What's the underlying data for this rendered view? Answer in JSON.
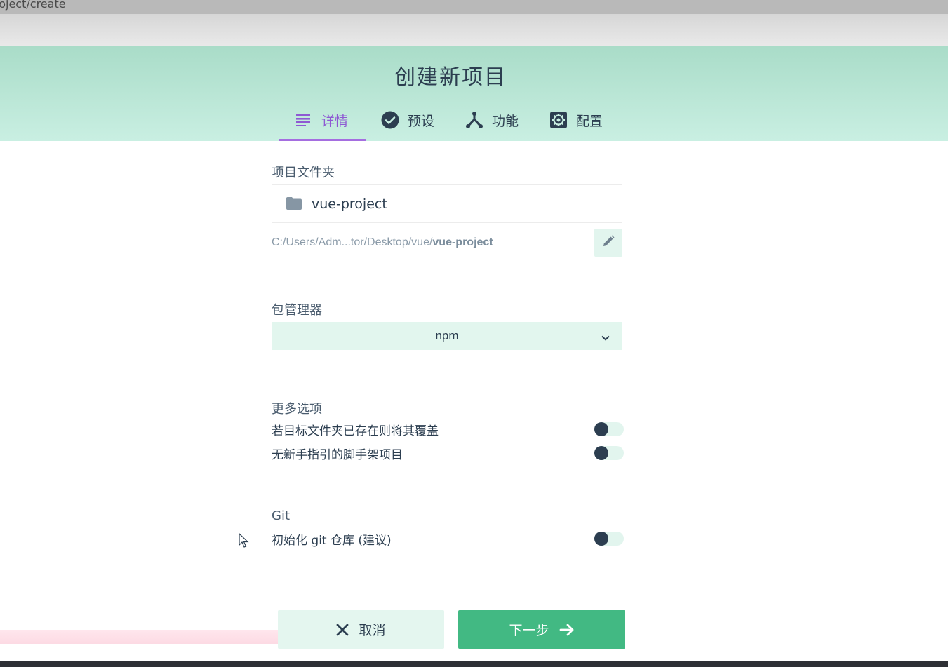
{
  "browser": {
    "url_fragment": "roject/create"
  },
  "header": {
    "title": "创建新项目",
    "tabs": [
      {
        "label": "详情",
        "icon": "list-icon",
        "active": true
      },
      {
        "label": "预设",
        "icon": "check-circle-icon",
        "active": false
      },
      {
        "label": "功能",
        "icon": "fork-icon",
        "active": false
      },
      {
        "label": "配置",
        "icon": "gear-icon",
        "active": false
      }
    ]
  },
  "project_folder": {
    "label": "项目文件夹",
    "value": "vue-project",
    "path_prefix": "C:/Users/Adm...tor/Desktop/vue/",
    "path_name": "vue-project"
  },
  "package_manager": {
    "label": "包管理器",
    "selected": "npm"
  },
  "more_options": {
    "label": "更多选项",
    "items": [
      {
        "label": "若目标文件夹已存在则将其覆盖",
        "enabled": false
      },
      {
        "label": "无新手指引的脚手架项目",
        "enabled": false
      }
    ]
  },
  "git": {
    "label": "Git",
    "items": [
      {
        "label": "初始化 git 仓库 (建议)",
        "enabled": false
      }
    ]
  },
  "actions": {
    "cancel_label": "取消",
    "next_label": "下一步"
  },
  "colors": {
    "accent": "#42b983",
    "tab_active": "#8e59d3",
    "text": "#2c3e50"
  }
}
